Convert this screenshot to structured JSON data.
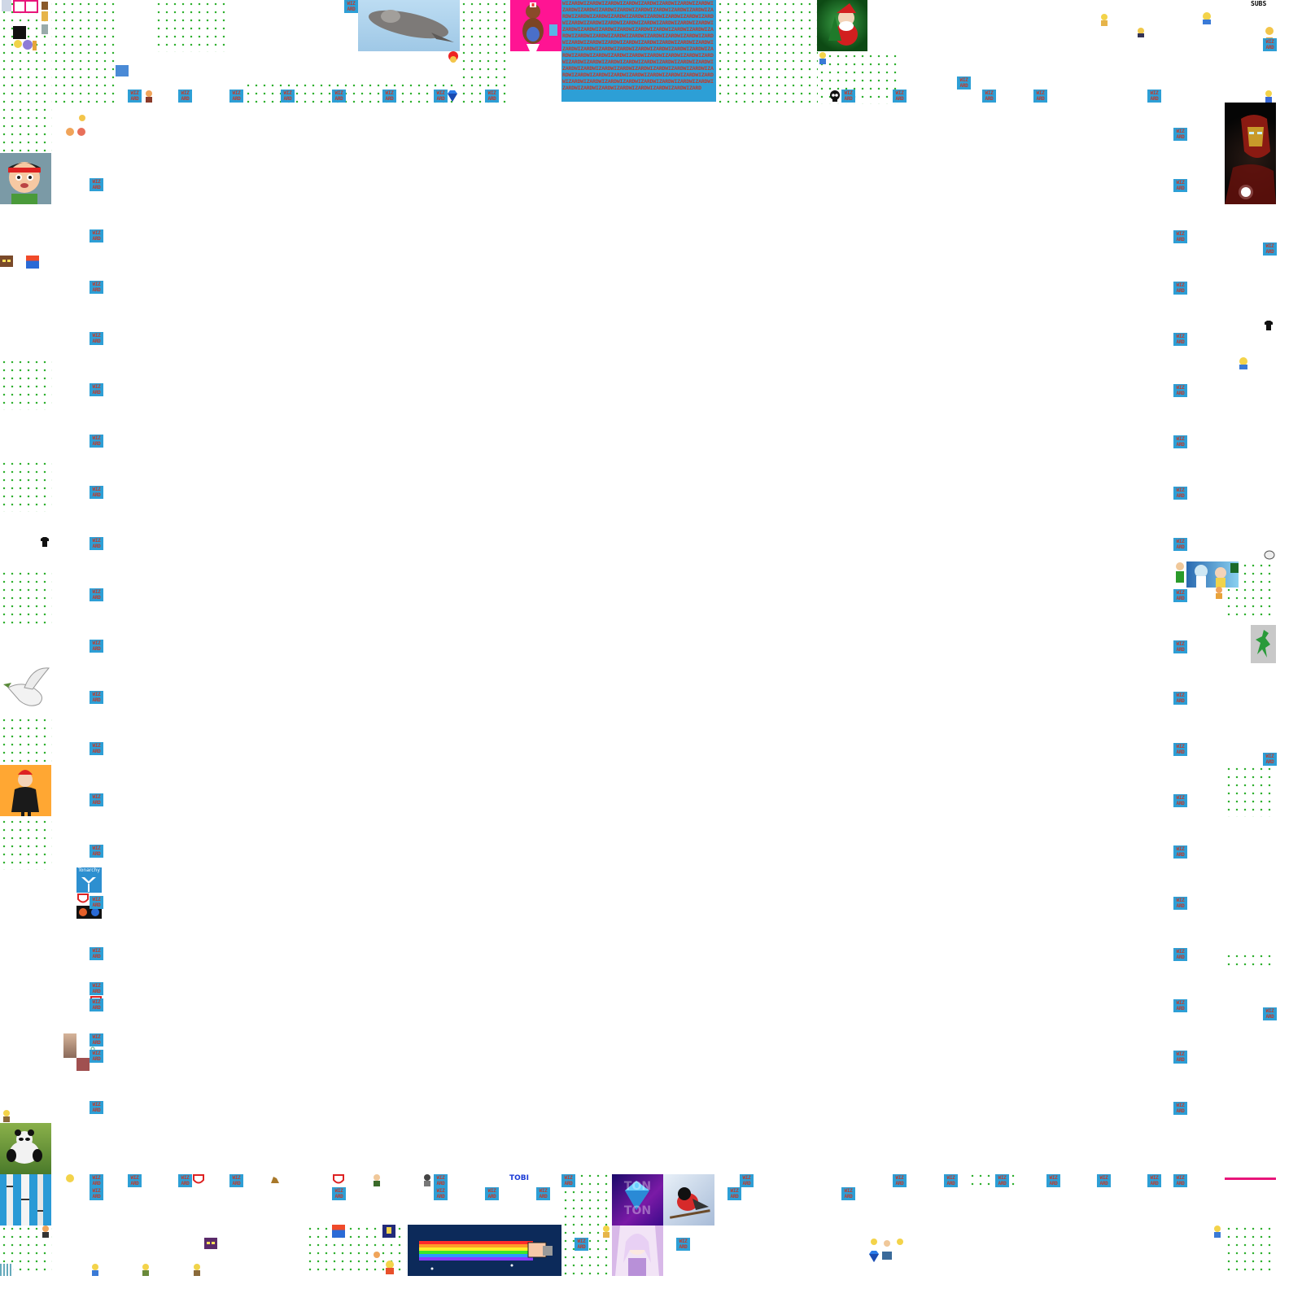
{
  "top_right_label": "SUBS",
  "wiz_label_top": "WIZ",
  "wiz_label_bottom": "ARD",
  "wiz_block_text": "WIZARDWIZARDWIZARDWIZARDWIZARDWIZARDWIZARDWIZARDWIZARDWIZARDWIZARDWIZARDWIZARDWIZARDWIZARDWIZARDWIZARDWIZARDWIZARDWIZARDWIZARDWIZARDWIZARDWIZARDWIZARDWIZARDWIZARDWIZARDWIZARDWIZARDWIZARDWIZARDWIZARDWIZARDWIZARDWIZARDWIZARDWIZARDWIZARDWIZARDWIZARDWIZARDWIZARDWIZARDWIZARDWIZARDWIZARDWIZARDWIZARDWIZARDWIZARDWIZARDWIZARDWIZARDWIZARDWIZARDWIZARDWIZARDWIZARDWIZARDWIZARDWIZARDWIZARDWIZARDWIZARDWIZARDWIZARDWIZARDWIZARDWIZARDWIZARDWIZARDWIZARDWIZARDWIZARDWIZARDWIZARDWIZARDWIZARDWIZARDWIZARDWIZARDWIZARDWIZARDWIZARDWIZARDWIZARDWIZARDWIZARDWIZARDWIZARDWIZARDWIZARDWIZARDWIZARDWIZARDWIZARDWIZARDWIZARDWIZARDWIZARDWIZARDWIZARDWIZARDWIZARDWIZARDWIZARDWIZARDWIZARDWIZARDWIZARDWIZARDWIZARDWIZARDWIZARDWIZARD",
  "tonarchy_label": "Tonarchy",
  "tobi_label": "TOBI",
  "tonton_label": "TON TON",
  "colors": {
    "dot_green": "#2fb02f",
    "wiz_blue": "#2d9fd6",
    "wiz_red": "#c23a2a",
    "magenta": "#e8157a",
    "hot_pink": "#ff1493",
    "orange": "#ffa733",
    "navy": "#0c2a5a",
    "dark_green": "#0d4a14"
  },
  "icons": [
    "flying-squirrel-image",
    "monkey-nurse-image",
    "santa-image",
    "iron-man-image",
    "cartoon-boy-image",
    "dove-image",
    "orange-character-image",
    "panda-image",
    "birch-trees-image",
    "nyan-cat-image",
    "diamond-icon",
    "bullfinch-image",
    "anime-girl-image",
    "rick-morty-image",
    "dragon-image",
    "skull-icon",
    "tshirt-icon",
    "simpson-sprite-icon",
    "pixel-face-icon"
  ]
}
